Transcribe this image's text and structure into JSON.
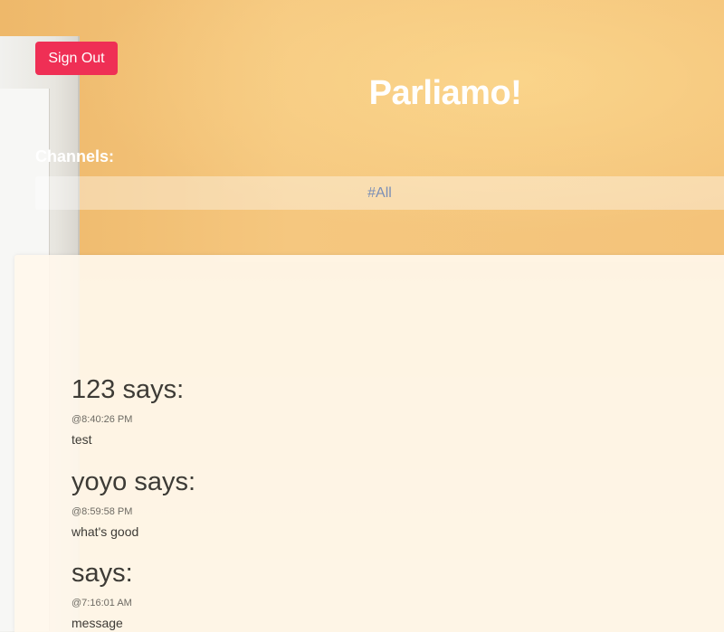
{
  "header": {
    "sign_out_label": "Sign Out",
    "app_title": "Parliamo!"
  },
  "channels": {
    "label": "Channels:",
    "items": [
      {
        "label": "#All"
      }
    ]
  },
  "messages": [
    {
      "author_line": "123 says:",
      "time": "@8:40:26 PM",
      "text": "test"
    },
    {
      "author_line": "yoyo says:",
      "time": "@8:59:58 PM",
      "text": "what's good"
    },
    {
      "author_line": "says:",
      "time": "@7:16:01 AM",
      "text": "message"
    }
  ],
  "colors": {
    "sign_out_button": "#ef2f55",
    "channel_link": "#7b8fb6"
  }
}
